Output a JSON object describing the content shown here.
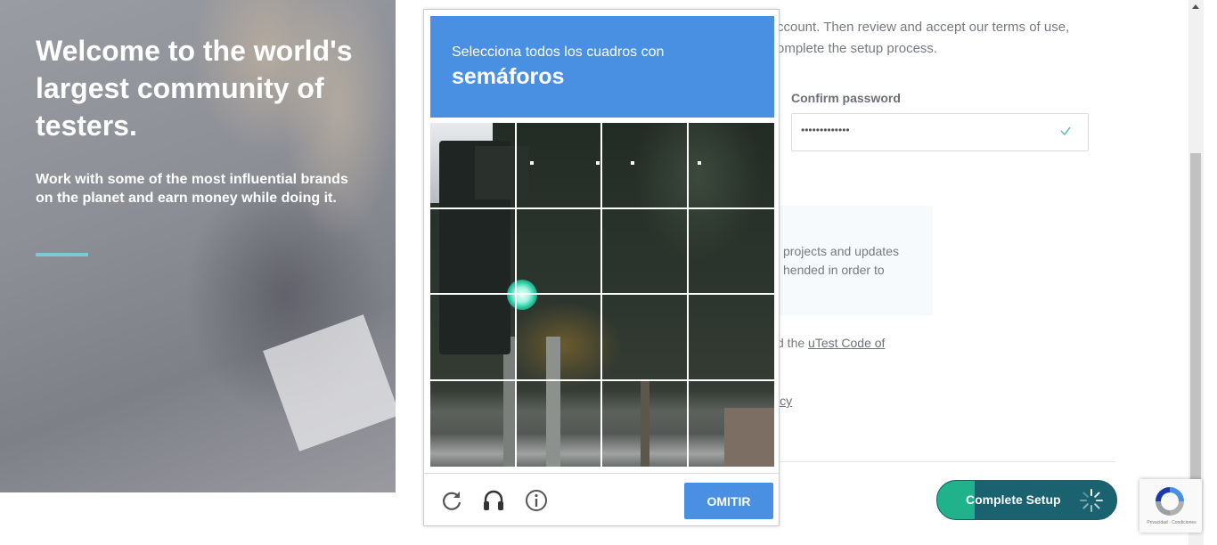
{
  "hero": {
    "title": "Welcome to the world's largest community of testers.",
    "subtitle": "Work with some of the most influential brands on the planet and earn money while doing it."
  },
  "form": {
    "intro_text": "ccount. Then review and accept our terms of use, omplete the setup process.",
    "confirm_password_label": "Confirm password",
    "confirm_password_value": "•••••••••••••",
    "info_text": "projects and updates hended in order to",
    "code_prefix": "d the ",
    "code_link": "uTest Code of",
    "policy_fragment": "icy",
    "complete_button": "Complete Setup"
  },
  "captcha": {
    "instruction": "Selecciona todos los cuadros con",
    "target": "semáforos",
    "skip_button": "OMITIR",
    "icons": [
      "reload-icon",
      "audio-icon",
      "info-icon"
    ]
  },
  "recaptcha_badge": {
    "footer": "Privacidad - Condiciones"
  },
  "colors": {
    "captcha_blue": "#4a90e2",
    "complete_teal": "#1b6270",
    "complete_green": "#20b28a",
    "accent_rule": "#7ec8d8"
  }
}
